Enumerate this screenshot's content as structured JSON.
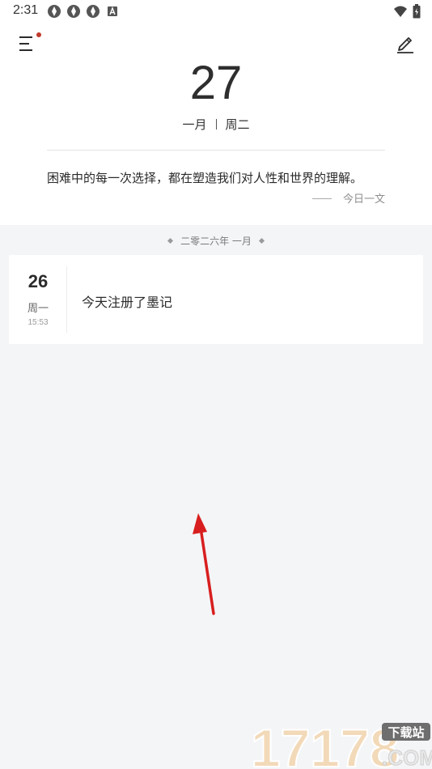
{
  "status_bar": {
    "time": "2:31"
  },
  "header": {
    "big_date": "27",
    "month": "一月",
    "weekday": "周二"
  },
  "quote": {
    "text": "困难中的每一次选择，都在塑造我们对人性和世界的理解。",
    "source": "今日一文"
  },
  "timeline": {
    "month_header": "二零二六年 一月",
    "entries": [
      {
        "day": "26",
        "weekday": "周一",
        "time": "15:53",
        "text": "今天注册了墨记"
      }
    ]
  },
  "watermark": {
    "digits": "17178",
    "badge": "下载站",
    "domain": ".COM"
  },
  "colors": {
    "accent_dot": "#c0392b",
    "arrow": "#d81e1e",
    "background": "#f4f5f7"
  }
}
